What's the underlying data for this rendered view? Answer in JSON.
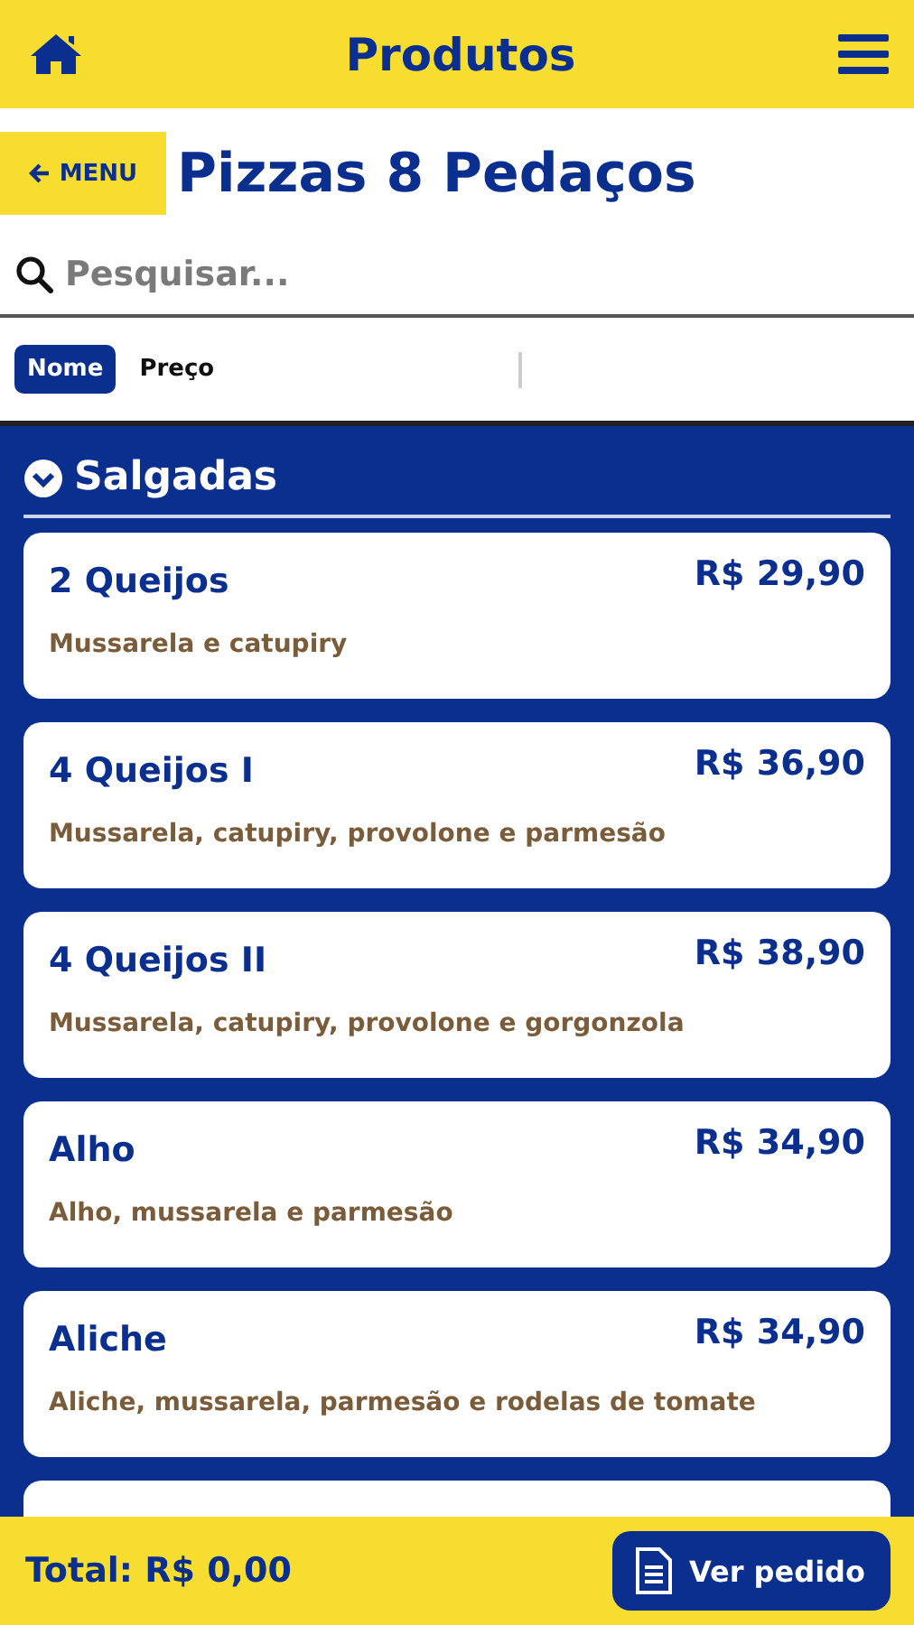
{
  "header": {
    "title": "Produtos"
  },
  "category": {
    "back_label": "MENU",
    "title": "Pizzas 8 Pedaços"
  },
  "search": {
    "placeholder": "Pesquisar..."
  },
  "sort": [
    {
      "label": "Nome",
      "selected": true
    },
    {
      "label": "Preço",
      "selected": false
    }
  ],
  "section": {
    "title": "Salgadas",
    "expanded": true
  },
  "products": [
    {
      "name": "2 Queijos",
      "price": "R$ 29,90",
      "description": "Mussarela e catupiry"
    },
    {
      "name": "4 Queijos I",
      "price": "R$ 36,90",
      "description": "Mussarela, catupiry, provolone e parmesão"
    },
    {
      "name": "4 Queijos II",
      "price": "R$ 38,90",
      "description": "Mussarela, catupiry, provolone e gorgonzola"
    },
    {
      "name": "Alho",
      "price": "R$ 34,90",
      "description": "Alho, mussarela e parmesão"
    },
    {
      "name": "Aliche",
      "price": "R$ 34,90",
      "description": "Aliche, mussarela, parmesão e rodelas de tomate"
    }
  ],
  "footer": {
    "total": "Total: R$ 0,00",
    "button": "Ver pedido"
  }
}
